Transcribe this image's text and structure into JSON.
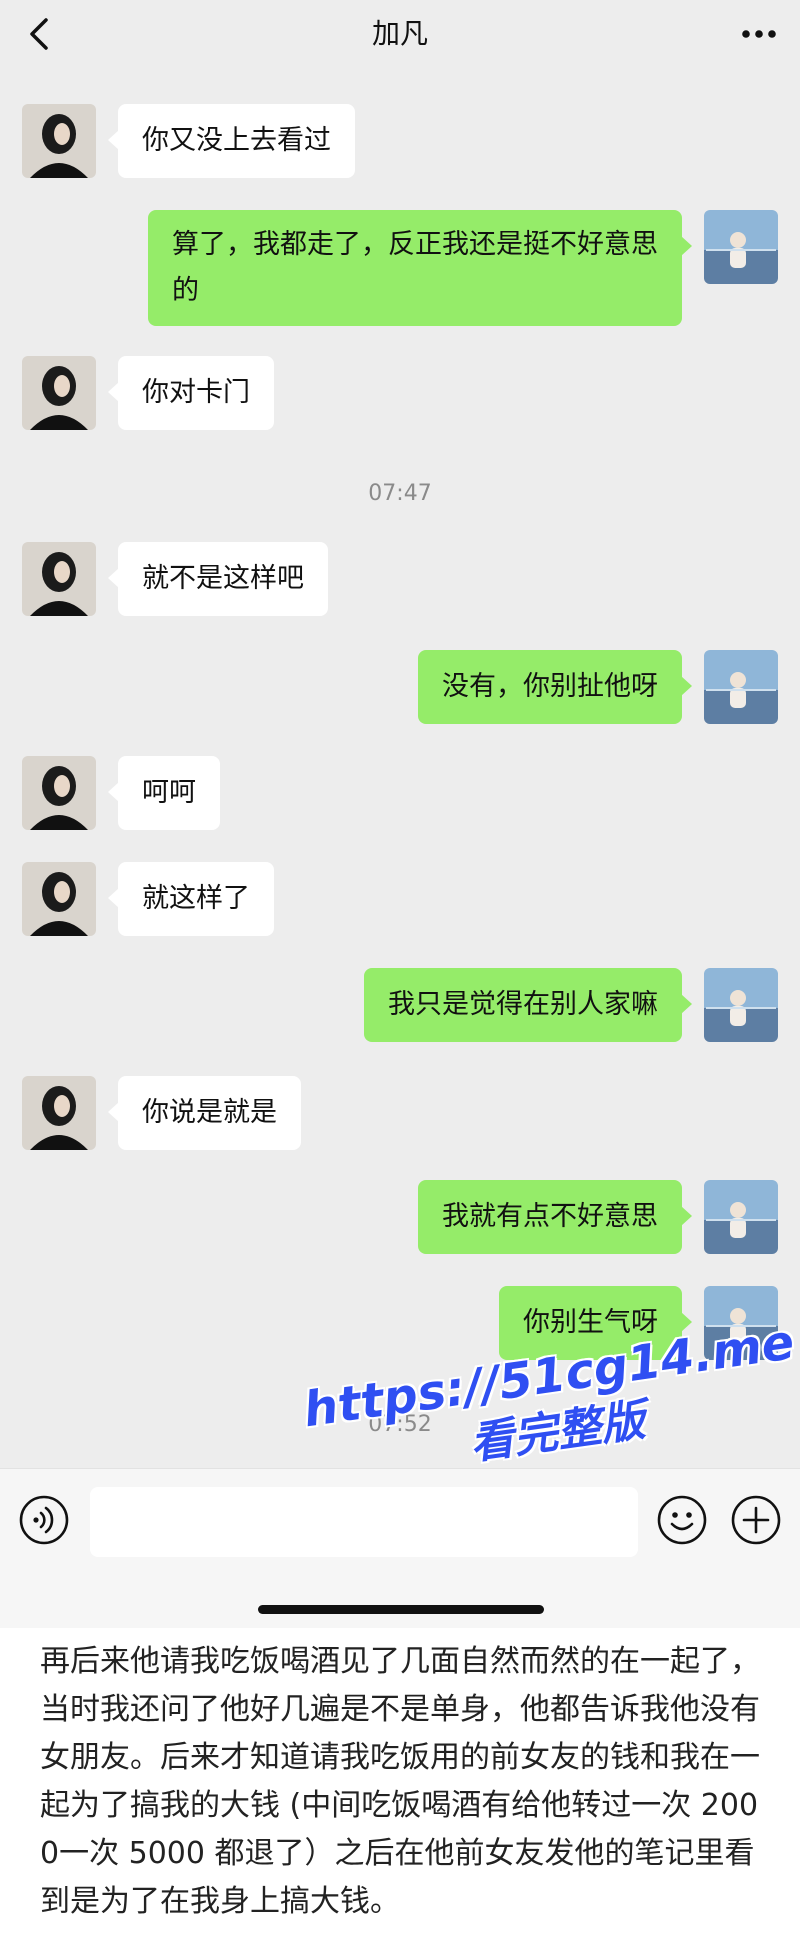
{
  "header": {
    "title": "加凡",
    "back_icon": "chevron-left-icon",
    "more_icon": "ellipsis-icon"
  },
  "messages": [
    {
      "sender": "other",
      "text": "你又没上去看过"
    },
    {
      "sender": "me",
      "text": "算了，我都走了，反正我还是挺不好意思的"
    },
    {
      "sender": "other",
      "text": "你对卡门"
    },
    {
      "sender": "other",
      "text": "就不是这样吧"
    },
    {
      "sender": "me",
      "text": "没有，你别扯他呀"
    },
    {
      "sender": "other",
      "text": "呵呵"
    },
    {
      "sender": "other",
      "text": "就这样了"
    },
    {
      "sender": "me",
      "text": "我只是觉得在别人家嘛"
    },
    {
      "sender": "other",
      "text": "你说是就是"
    },
    {
      "sender": "me",
      "text": "我就有点不好意思"
    },
    {
      "sender": "me",
      "text": "你别生气呀"
    }
  ],
  "timestamps": [
    "07:47",
    "07:52"
  ],
  "input_bar": {
    "voice_icon": "voice-icon",
    "input_value": "",
    "emoji_icon": "emoji-icon",
    "plus_icon": "plus-icon"
  },
  "watermark": {
    "url": "https://51cg14.me",
    "subtitle": "看完整版"
  },
  "caption": "再后来他请我吃饭喝酒见了几面自然而然的在一起了，当时我还问了他好几遍是不是单身，他都告诉我他没有女朋友。后来才知道请我吃饭用的前女友的钱和我在一起为了搞我的大钱 (中间吃饭喝酒有给他转过一次 200 0一次 5000 都退了）之后在他前女友发他的笔记里看到是为了在我身上搞大钱。",
  "colors": {
    "chat_background": "#ededed",
    "sent_bubble": "#95ec69",
    "received_bubble": "#ffffff",
    "watermark": "#2f4ff2"
  }
}
